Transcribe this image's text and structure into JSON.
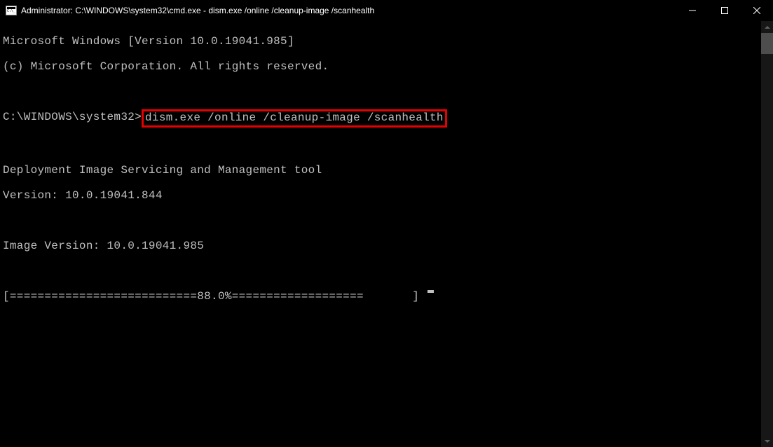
{
  "titlebar": {
    "text": "Administrator: C:\\WINDOWS\\system32\\cmd.exe - dism.exe  /online /cleanup-image /scanhealth"
  },
  "terminal": {
    "line_version": "Microsoft Windows [Version 10.0.19041.985]",
    "line_copyright": "(c) Microsoft Corporation. All rights reserved.",
    "prompt_prefix": "C:\\WINDOWS\\system32>",
    "command": "dism.exe /online /cleanup-image /scanhealth",
    "dism_title": "Deployment Image Servicing and Management tool",
    "dism_version": "Version: 10.0.19041.844",
    "image_version": "Image Version: 10.0.19041.985",
    "progress_line": "[===========================88.0%===================       ] "
  }
}
